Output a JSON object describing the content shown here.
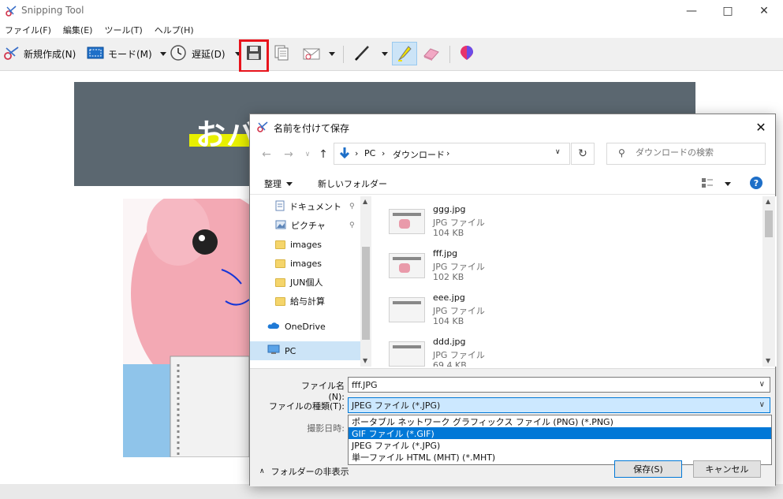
{
  "app": {
    "title": "Snipping Tool",
    "menu": [
      "ファイル(F)",
      "編集(E)",
      "ツール(T)",
      "ヘルプ(H)"
    ]
  },
  "toolbar": {
    "new_label": "新規作成(N)",
    "mode_label": "モード(M)",
    "delay_label": "遅延(D)"
  },
  "canvas": {
    "banner_text": "おバ"
  },
  "dialog": {
    "title": "名前を付けて保存",
    "breadcrumb": [
      "PC",
      "ダウンロード"
    ],
    "search_placeholder": "ダウンロードの検索",
    "organize_label": "整理",
    "new_folder_label": "新しいフォルダー",
    "nav_items": [
      {
        "label": "ドキュメント",
        "icon": "document-icon",
        "pinned": true
      },
      {
        "label": "ピクチャ",
        "icon": "picture-icon",
        "pinned": true
      },
      {
        "label": "images",
        "icon": "folder-icon"
      },
      {
        "label": "images",
        "icon": "folder-icon"
      },
      {
        "label": "JUN個人",
        "icon": "folder-icon"
      },
      {
        "label": "給与計算",
        "icon": "folder-icon"
      },
      {
        "label": "OneDrive",
        "icon": "cloud-icon"
      },
      {
        "label": "PC",
        "icon": "computer-icon"
      }
    ],
    "files": [
      {
        "name": "ggg.jpg",
        "type": "JPG ファイル",
        "size": "104 KB"
      },
      {
        "name": "fff.jpg",
        "type": "JPG ファイル",
        "size": "102 KB"
      },
      {
        "name": "eee.jpg",
        "type": "JPG ファイル",
        "size": "104 KB"
      },
      {
        "name": "ddd.jpg",
        "type": "JPG ファイル",
        "size": "69.4 KB"
      }
    ],
    "filename_label": "ファイル名(N):",
    "filename_value": "fff.JPG",
    "filetype_label": "ファイルの種類(T):",
    "filetype_value": "JPEG ファイル (*.JPG)",
    "filetype_options": [
      "ポータブル ネットワーク グラフィックス ファイル (PNG) (*.PNG)",
      "GIF ファイル (*.GIF)",
      "JPEG ファイル (*.JPG)",
      "単一ファイル HTML (MHT) (*.MHT)"
    ],
    "selected_option_index": 1,
    "date_label": "撮影日時:",
    "hide_folders_label": "フォルダーの非表示",
    "save_label": "保存(S)",
    "cancel_label": "キャンセル"
  },
  "colors": {
    "accent": "#0078d7",
    "highlight_border": "#e8141c",
    "banner_bg": "#5b6770"
  }
}
